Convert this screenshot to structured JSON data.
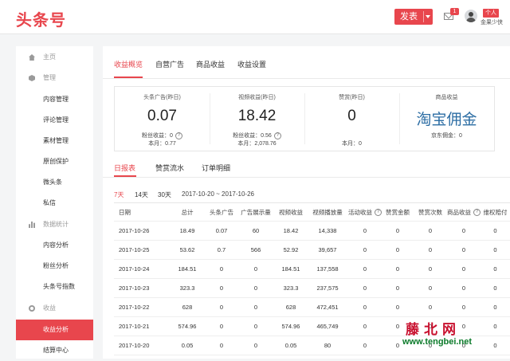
{
  "header": {
    "logo": "头条号",
    "publish_label": "发表",
    "mail_badge": "1",
    "user_tag": "个人",
    "user_name": "金果少侠"
  },
  "sidebar": {
    "items": [
      {
        "label": "主页",
        "icon": "home-icon",
        "type": "group"
      },
      {
        "label": "管理",
        "icon": "box-icon",
        "type": "group"
      },
      {
        "label": "内容管理",
        "type": "sub"
      },
      {
        "label": "评论管理",
        "type": "sub"
      },
      {
        "label": "素材管理",
        "type": "sub"
      },
      {
        "label": "原创保护",
        "type": "sub"
      },
      {
        "label": "微头条",
        "type": "sub"
      },
      {
        "label": "私信",
        "type": "sub"
      },
      {
        "label": "数据统计",
        "icon": "bar-chart-icon",
        "type": "group"
      },
      {
        "label": "内容分析",
        "type": "sub"
      },
      {
        "label": "粉丝分析",
        "type": "sub"
      },
      {
        "label": "头条号指数",
        "type": "sub"
      },
      {
        "label": "收益",
        "icon": "coin-icon",
        "type": "group"
      },
      {
        "label": "收益分析",
        "type": "sub",
        "active": true
      },
      {
        "label": "结算中心",
        "type": "sub"
      }
    ]
  },
  "tabs": [
    "收益概览",
    "自营广告",
    "商品收益",
    "收益设置"
  ],
  "stats": [
    {
      "title": "头条广告(昨日)",
      "value": "0.07",
      "line1": "粉丝收益：0",
      "line2": "本月：0.77"
    },
    {
      "title": "视频收益(昨日)",
      "value": "18.42",
      "line1": "粉丝收益：0.56",
      "line2": "本月：2,078.76"
    },
    {
      "title": "赞赏(昨日)",
      "value": "0",
      "line1": "",
      "line2": "本月：0"
    },
    {
      "title": "商品收益",
      "value": "淘宝佣金",
      "line1": "京东佣金：0",
      "line2": ""
    }
  ],
  "subtabs": [
    "日报表",
    "赞赏流水",
    "订单明细"
  ],
  "ranges": [
    "7天",
    "14天",
    "30天"
  ],
  "date_range": "2017-10-20  ~  2017-10-26",
  "table": {
    "headers": [
      "日期",
      "总计",
      "头条广告",
      "广告展示量",
      "视频收益",
      "视频播放量",
      "活动收益",
      "赞赏金额",
      "赞赏次数",
      "商品收益",
      "维权赔付"
    ],
    "rows": [
      [
        "2017-10-26",
        "18.49",
        "0.07",
        "60",
        "18.42",
        "14,338",
        "0",
        "0",
        "0",
        "0",
        "0"
      ],
      [
        "2017-10-25",
        "53.62",
        "0.7",
        "566",
        "52.92",
        "39,657",
        "0",
        "0",
        "0",
        "0",
        "0"
      ],
      [
        "2017-10-24",
        "184.51",
        "0",
        "0",
        "184.51",
        "137,558",
        "0",
        "0",
        "0",
        "0",
        "0"
      ],
      [
        "2017-10-23",
        "323.3",
        "0",
        "0",
        "323.3",
        "237,575",
        "0",
        "0",
        "0",
        "0",
        "0"
      ],
      [
        "2017-10-22",
        "628",
        "0",
        "0",
        "628",
        "472,451",
        "0",
        "0",
        "0",
        "0",
        "0"
      ],
      [
        "2017-10-21",
        "574.96",
        "0",
        "0",
        "574.96",
        "465,749",
        "0",
        "0",
        "0",
        "0",
        "0"
      ],
      [
        "2017-10-20",
        "0.05",
        "0",
        "0",
        "0.05",
        "80",
        "0",
        "0",
        "0",
        "0",
        "0"
      ]
    ]
  },
  "watermark": {
    "title": "藤北网",
    "url": "www.tengbei.net"
  },
  "colors": {
    "accent": "#e8464d",
    "brand_blue": "#2d6ea4"
  }
}
